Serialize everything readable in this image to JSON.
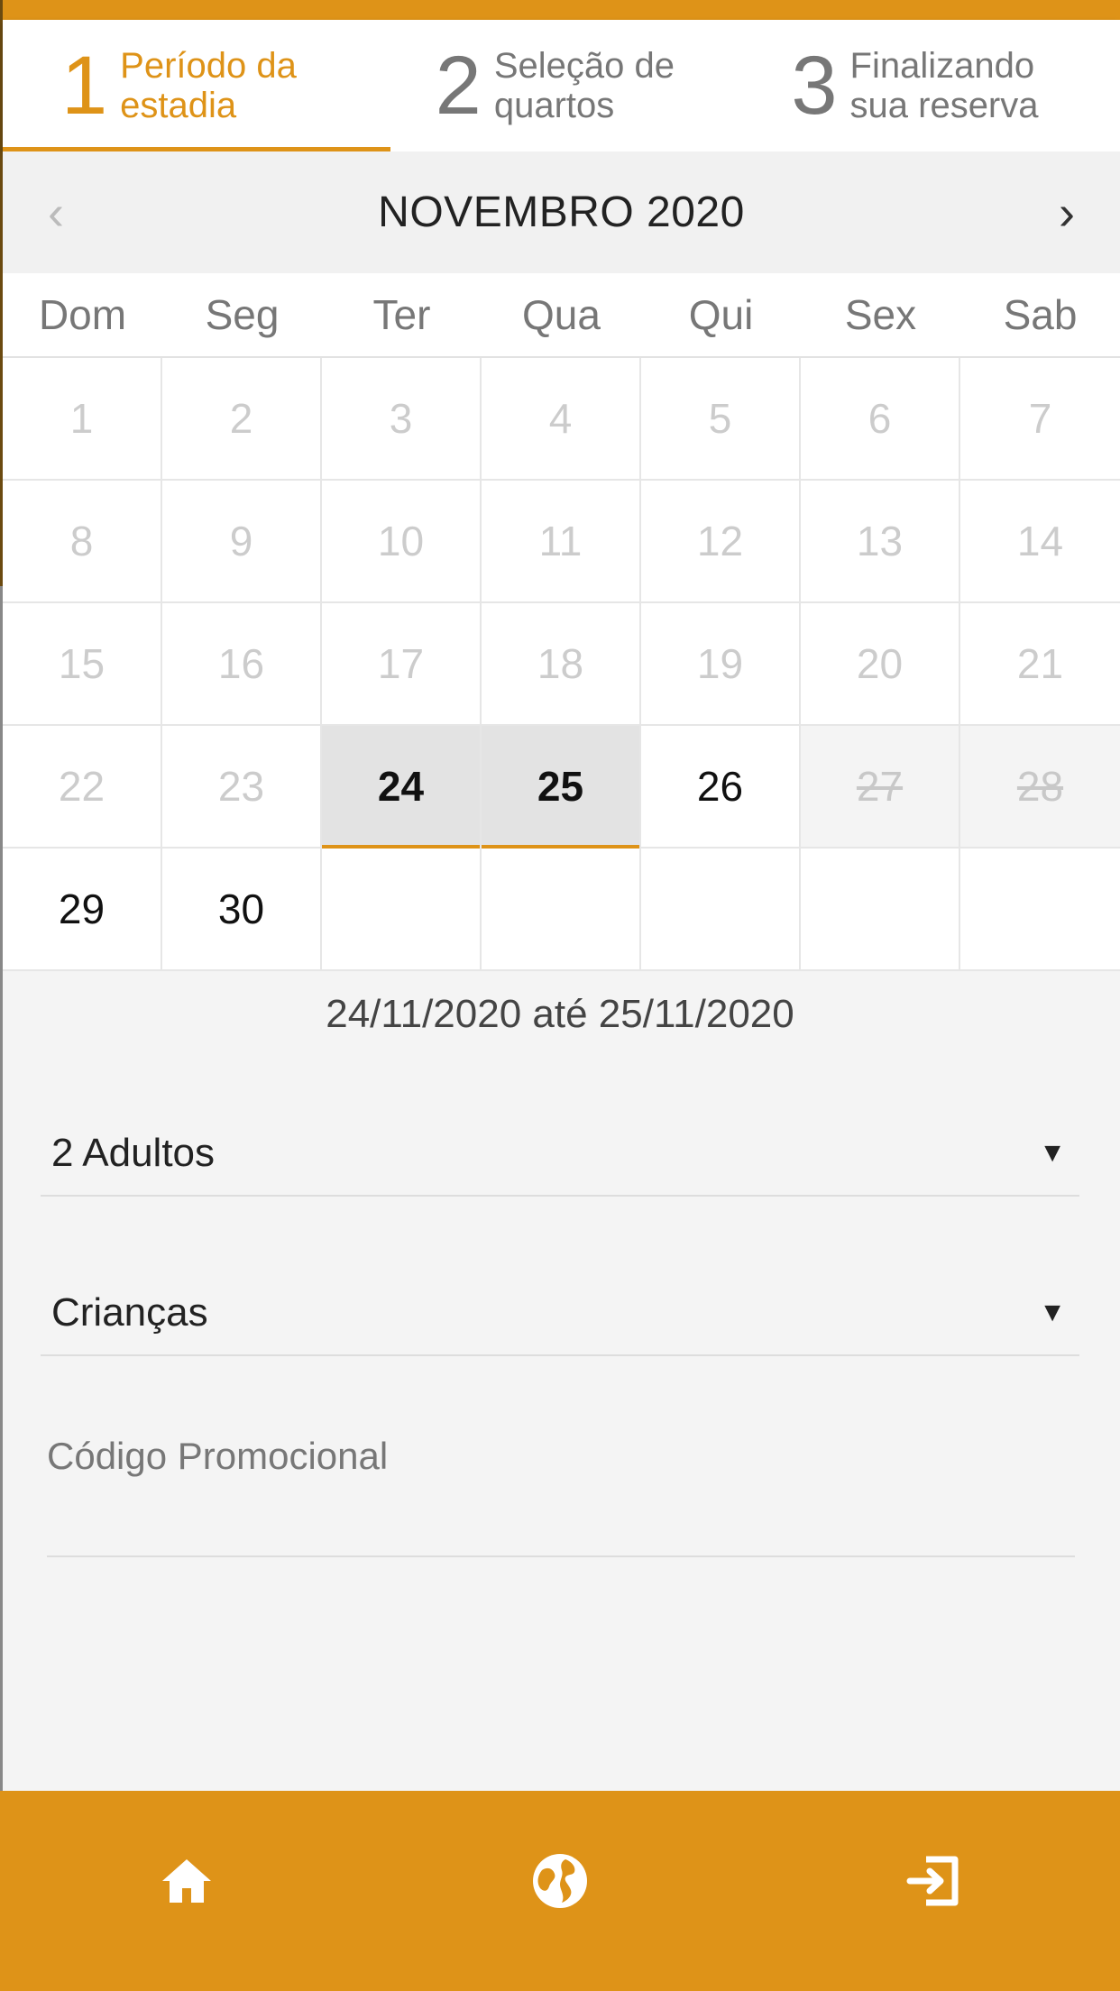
{
  "steps": [
    {
      "number": "1",
      "label": "Período da\nestadia",
      "active": true
    },
    {
      "number": "2",
      "label": "Seleção de\nquartos",
      "active": false
    },
    {
      "number": "3",
      "label": "Finalizando\nsua reserva",
      "active": false
    }
  ],
  "calendar": {
    "month_label": "NOVEMBRO 2020",
    "prev_arrow": "‹",
    "next_arrow": "›",
    "weekdays": [
      "Dom",
      "Seg",
      "Ter",
      "Qua",
      "Qui",
      "Sex",
      "Sab"
    ],
    "days": [
      {
        "label": "1",
        "state": "past"
      },
      {
        "label": "2",
        "state": "past"
      },
      {
        "label": "3",
        "state": "past"
      },
      {
        "label": "4",
        "state": "past"
      },
      {
        "label": "5",
        "state": "past"
      },
      {
        "label": "6",
        "state": "past"
      },
      {
        "label": "7",
        "state": "past"
      },
      {
        "label": "8",
        "state": "past"
      },
      {
        "label": "9",
        "state": "past"
      },
      {
        "label": "10",
        "state": "past"
      },
      {
        "label": "11",
        "state": "past"
      },
      {
        "label": "12",
        "state": "past"
      },
      {
        "label": "13",
        "state": "past"
      },
      {
        "label": "14",
        "state": "past"
      },
      {
        "label": "15",
        "state": "past"
      },
      {
        "label": "16",
        "state": "past"
      },
      {
        "label": "17",
        "state": "past"
      },
      {
        "label": "18",
        "state": "past"
      },
      {
        "label": "19",
        "state": "past"
      },
      {
        "label": "20",
        "state": "past"
      },
      {
        "label": "21",
        "state": "past"
      },
      {
        "label": "22",
        "state": "past"
      },
      {
        "label": "23",
        "state": "past"
      },
      {
        "label": "24",
        "state": "selected"
      },
      {
        "label": "25",
        "state": "selected"
      },
      {
        "label": "26",
        "state": "available"
      },
      {
        "label": "27",
        "state": "blocked"
      },
      {
        "label": "28",
        "state": "blocked"
      },
      {
        "label": "29",
        "state": "available"
      },
      {
        "label": "30",
        "state": "available"
      },
      {
        "label": "",
        "state": "empty"
      },
      {
        "label": "",
        "state": "empty"
      },
      {
        "label": "",
        "state": "empty"
      },
      {
        "label": "",
        "state": "empty"
      },
      {
        "label": "",
        "state": "empty"
      }
    ]
  },
  "selection": {
    "range_text": "24/11/2020 até 25/11/2020"
  },
  "form": {
    "adults": {
      "value": "2 Adultos",
      "caret": "▼"
    },
    "children": {
      "value": "Crianças",
      "caret": "▼"
    },
    "promo": {
      "placeholder": "Código Promocional",
      "value": ""
    }
  },
  "bottom_nav": [
    {
      "icon": "home-icon"
    },
    {
      "icon": "globe-icon"
    },
    {
      "icon": "login-icon"
    }
  ],
  "colors": {
    "accent": "#de9318",
    "selected_day_bg": "#e3e3e3",
    "page_bg": "#f4f4f4"
  }
}
